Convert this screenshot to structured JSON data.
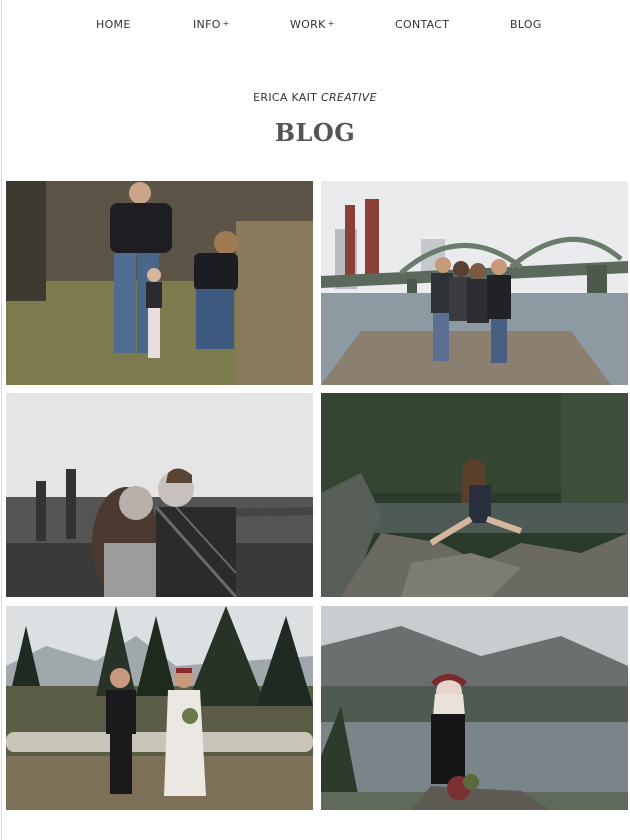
{
  "nav": {
    "items": [
      {
        "label": "HOME",
        "plus": ""
      },
      {
        "label": "INFO",
        "plus": "+"
      },
      {
        "label": "WORK",
        "plus": "+"
      },
      {
        "label": "CONTACT",
        "plus": ""
      },
      {
        "label": "BLOG",
        "plus": ""
      }
    ]
  },
  "brand": {
    "name": "ERICA KAIT",
    "tagline": "CREATIVE"
  },
  "page": {
    "title": "BLOG"
  },
  "posts": [
    {
      "icon": "family-in-meadow-photo"
    },
    {
      "icon": "family-on-dock-bridge-photo"
    },
    {
      "icon": "couple-bridge-bw-photo"
    },
    {
      "icon": "woman-on-rocks-photo"
    },
    {
      "icon": "wedding-couple-log-photo"
    },
    {
      "icon": "woman-flower-crown-river-photo"
    }
  ]
}
